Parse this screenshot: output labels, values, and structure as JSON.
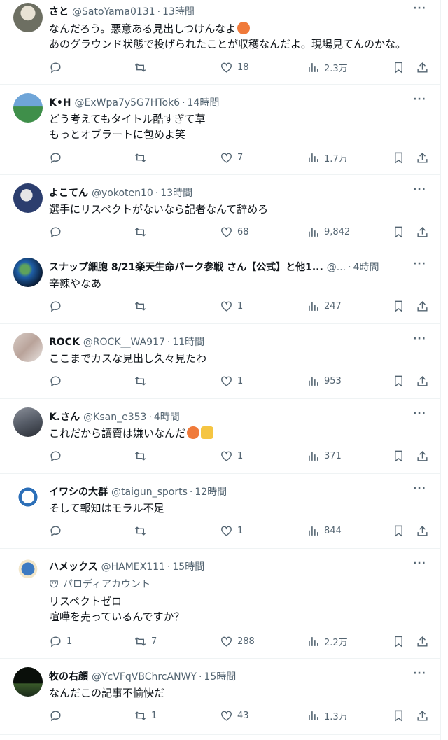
{
  "tweets": [
    {
      "name": "さと",
      "handle": "@SatoYama0131",
      "time": "13時間",
      "lines": [
        "なんだろう。悪意ある見出しつけんなよ",
        "あのグラウンド状態で投げられたことが収穫なんだよ。現場見てんのかな。"
      ],
      "reply": "",
      "retweet": "",
      "like": "18",
      "views": "2.3万",
      "avatar": "#6d6f62"
    },
    {
      "name": "K•H",
      "handle": "@ExWpa7y5G7HTok6",
      "time": "14時間",
      "lines": [
        "どう考えてもタイトル酷すぎて草",
        "もっとオブラートに包めよ笑"
      ],
      "reply": "",
      "retweet": "",
      "like": "7",
      "views": "1.7万",
      "avatar": "#3f8f4a"
    },
    {
      "name": "よこてん",
      "handle": "@yokoten10",
      "time": "13時間",
      "lines": [
        "選手にリスペクトがないなら記者なんて辞めろ"
      ],
      "reply": "",
      "retweet": "",
      "like": "68",
      "views": "9,842",
      "avatar": "#2c3e6e"
    },
    {
      "name": "スナップ細胞 8/21楽天生命パーク参戦 さん【公式】と他1...",
      "handle": "@...",
      "time": "4時間",
      "lines": [
        "辛辣やなあ"
      ],
      "reply": "",
      "retweet": "",
      "like": "1",
      "views": "247",
      "avatar": "#1f5fa8"
    },
    {
      "name": "ROCK",
      "handle": "@ROCK__WA917",
      "time": "11時間",
      "lines": [
        "ここまでカスな見出し久々見たわ"
      ],
      "reply": "",
      "retweet": "",
      "like": "1",
      "views": "953",
      "avatar": "#b9a39a"
    },
    {
      "name": "K.さん",
      "handle": "@Ksan_e353",
      "time": "4時間",
      "lines": [
        "これだから讀賣は嫌いなんだ"
      ],
      "reply": "",
      "retweet": "",
      "like": "1",
      "views": "371",
      "avatar": "#555b66"
    },
    {
      "name": "イワシの大群",
      "handle": "@taigun_sports",
      "time": "12時間",
      "lines": [
        "そして報知はモラル不足"
      ],
      "reply": "",
      "retweet": "",
      "like": "1",
      "views": "844",
      "avatar": "#2c6fb8"
    },
    {
      "name": "ハメックス",
      "handle": "@HAMEX111",
      "time": "15時間",
      "parody": "パロディアカウント",
      "lines": [
        "リスペクトゼロ",
        "喧嘩を売っているんですか？"
      ],
      "reply": "1",
      "retweet": "7",
      "like": "288",
      "views": "2.2万",
      "avatar": "#3d7ac2"
    },
    {
      "name": "牧の右顔",
      "handle": "@YcVFqVBChrcANWY",
      "time": "15時間",
      "lines": [
        "なんだこの記事不愉快だ"
      ],
      "reply": "",
      "retweet": "1",
      "like": "43",
      "views": "1.3万",
      "avatar": "#1a2a1a"
    }
  ],
  "more_label": "···"
}
